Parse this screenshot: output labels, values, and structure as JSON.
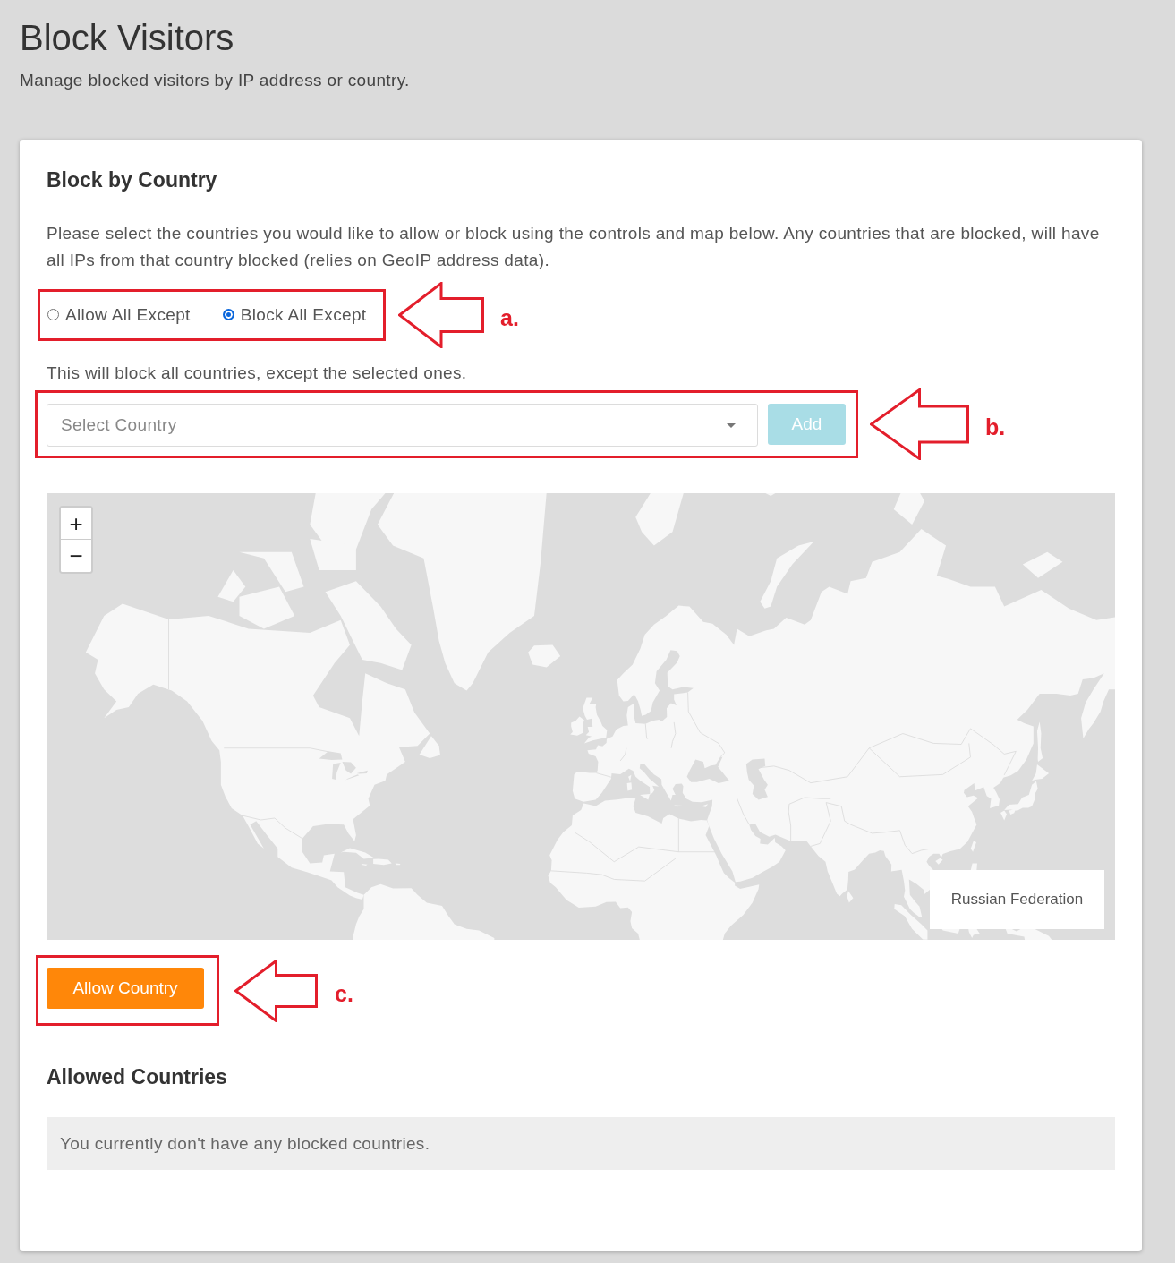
{
  "page": {
    "title": "Block Visitors",
    "subtitle": "Manage blocked visitors by IP address or country."
  },
  "card": {
    "title": "Block by Country",
    "description": "Please select the countries you would like to allow or block using the controls and map below. Any countries that are blocked, will have all IPs from that country blocked (relies on GeoIP address data).",
    "mode": {
      "options": [
        {
          "label": "Allow All Except",
          "selected": false
        },
        {
          "label": "Block All Except",
          "selected": true
        }
      ],
      "callout": "a."
    },
    "mode_hint": "This will block all countries, except the selected ones.",
    "country_picker": {
      "placeholder": "Select Country",
      "add_button": {
        "label": "Add",
        "disabled": true
      },
      "callout": "b."
    },
    "map": {
      "zoom_in": "+",
      "zoom_out": "−",
      "tooltip": "Russian Federation"
    },
    "allow_button": {
      "label": "Allow Country",
      "callout": "c."
    },
    "allowed_list": {
      "title": "Allowed Countries",
      "empty_message": "You currently don't have any blocked countries."
    }
  }
}
